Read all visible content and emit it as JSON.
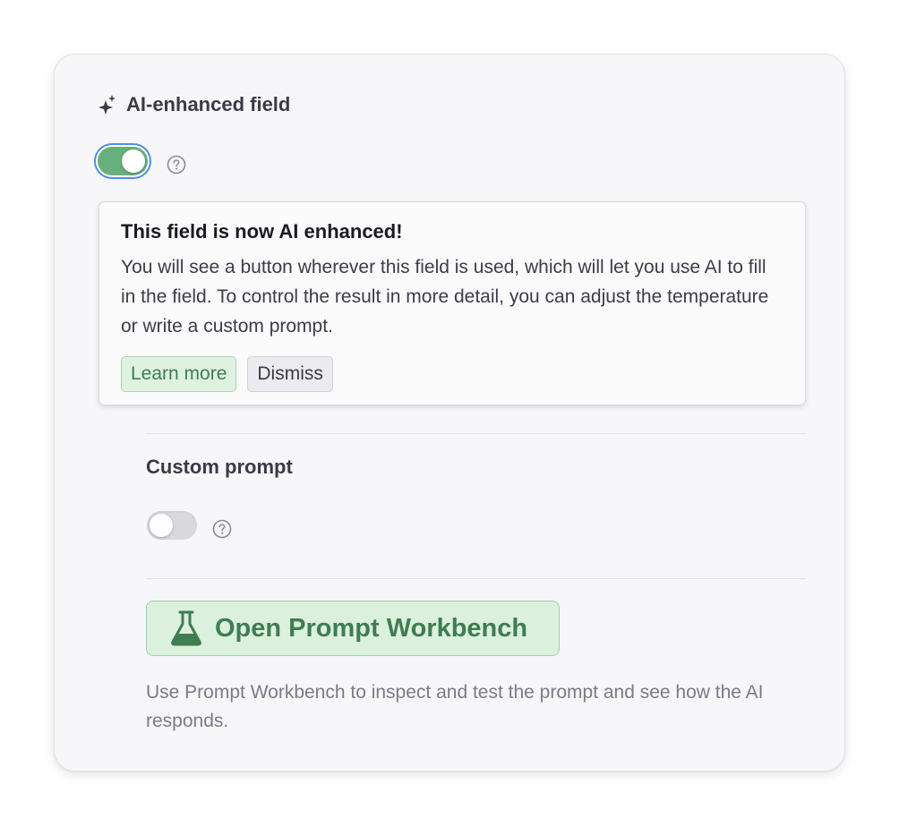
{
  "ai_field": {
    "title": "AI-enhanced field",
    "toggle_state": "on",
    "icon": "sparkle-icon",
    "help_icon": "question-circle-icon"
  },
  "notice": {
    "title": "This field is now AI enhanced!",
    "body": "You will see a button wherever this field is used, which will let you use AI to fill in the field. To control the result in more detail, you can adjust the temperature or write a custom prompt.",
    "learn_more_label": "Learn more",
    "dismiss_label": "Dismiss"
  },
  "custom_prompt": {
    "title": "Custom prompt",
    "toggle_state": "off",
    "help_icon": "question-circle-icon"
  },
  "workbench": {
    "button_label": "Open Prompt Workbench",
    "icon": "flask-icon",
    "helper_text": "Use Prompt Workbench to inspect and test the prompt and see how the AI responds."
  },
  "colors": {
    "accent_green": "#67b07e",
    "focus_ring": "#4c8fe6",
    "button_text_green": "#3f7d52"
  }
}
